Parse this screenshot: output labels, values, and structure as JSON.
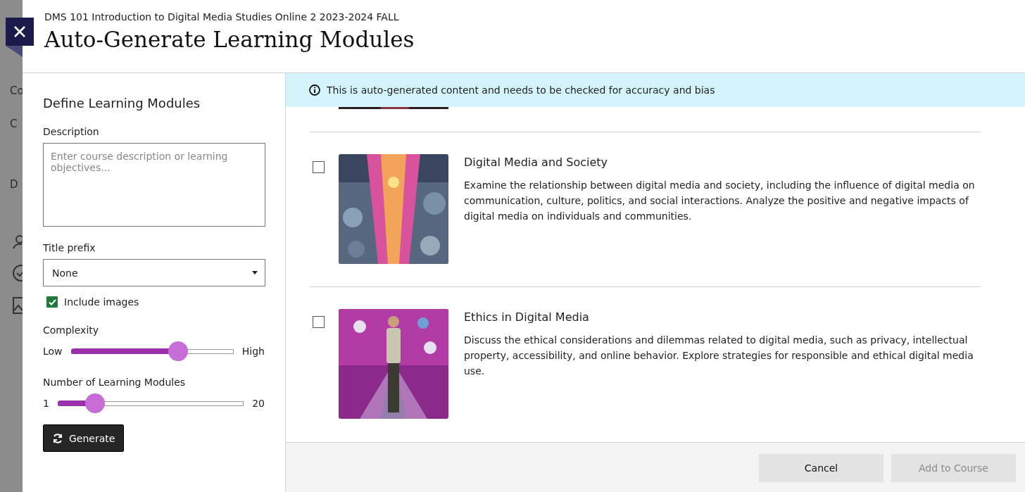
{
  "backdrop": {
    "texts": [
      "Co",
      "C",
      "D"
    ]
  },
  "header": {
    "course": "DMS 101 Introduction to Digital Media Studies Online 2 2023-2024 FALL",
    "title": "Auto-Generate Learning Modules"
  },
  "form": {
    "heading": "Define Learning Modules",
    "description": {
      "label": "Description",
      "placeholder": "Enter course description or learning objectives..."
    },
    "title_prefix": {
      "label": "Title prefix",
      "value": "None"
    },
    "include_images": {
      "label": "Include images",
      "checked": true
    },
    "sliders": [
      {
        "label": "Complexity",
        "min_label": "Low",
        "max_label": "High",
        "level": 0.66
      },
      {
        "label": "Number of Learning Modules",
        "min_label": "1",
        "max_label": "20",
        "level": 0.2
      }
    ],
    "generate_button": "Generate"
  },
  "notice": "This is auto-generated content and needs to be checked for accuracy and bias",
  "modules": [
    {
      "kind": "crowd",
      "title": "Digital Media and Society",
      "description": "Examine the relationship between digital media and society, including the influence of digital media on communication, culture, politics, and social interactions. Analyze the positive and negative impacts of digital media on individuals and communities.",
      "checked": false
    },
    {
      "kind": "figure",
      "title": "Ethics in Digital Media",
      "description": "Discuss the ethical considerations and dilemmas related to digital media, such as privacy, intellectual property, accessibility, and online behavior. Explore strategies for responsible and ethical digital media use.",
      "checked": false
    }
  ],
  "footer_buttons": [
    {
      "label": "Cancel",
      "disabled": false
    },
    {
      "label": "Add to Course",
      "disabled": true
    }
  ]
}
